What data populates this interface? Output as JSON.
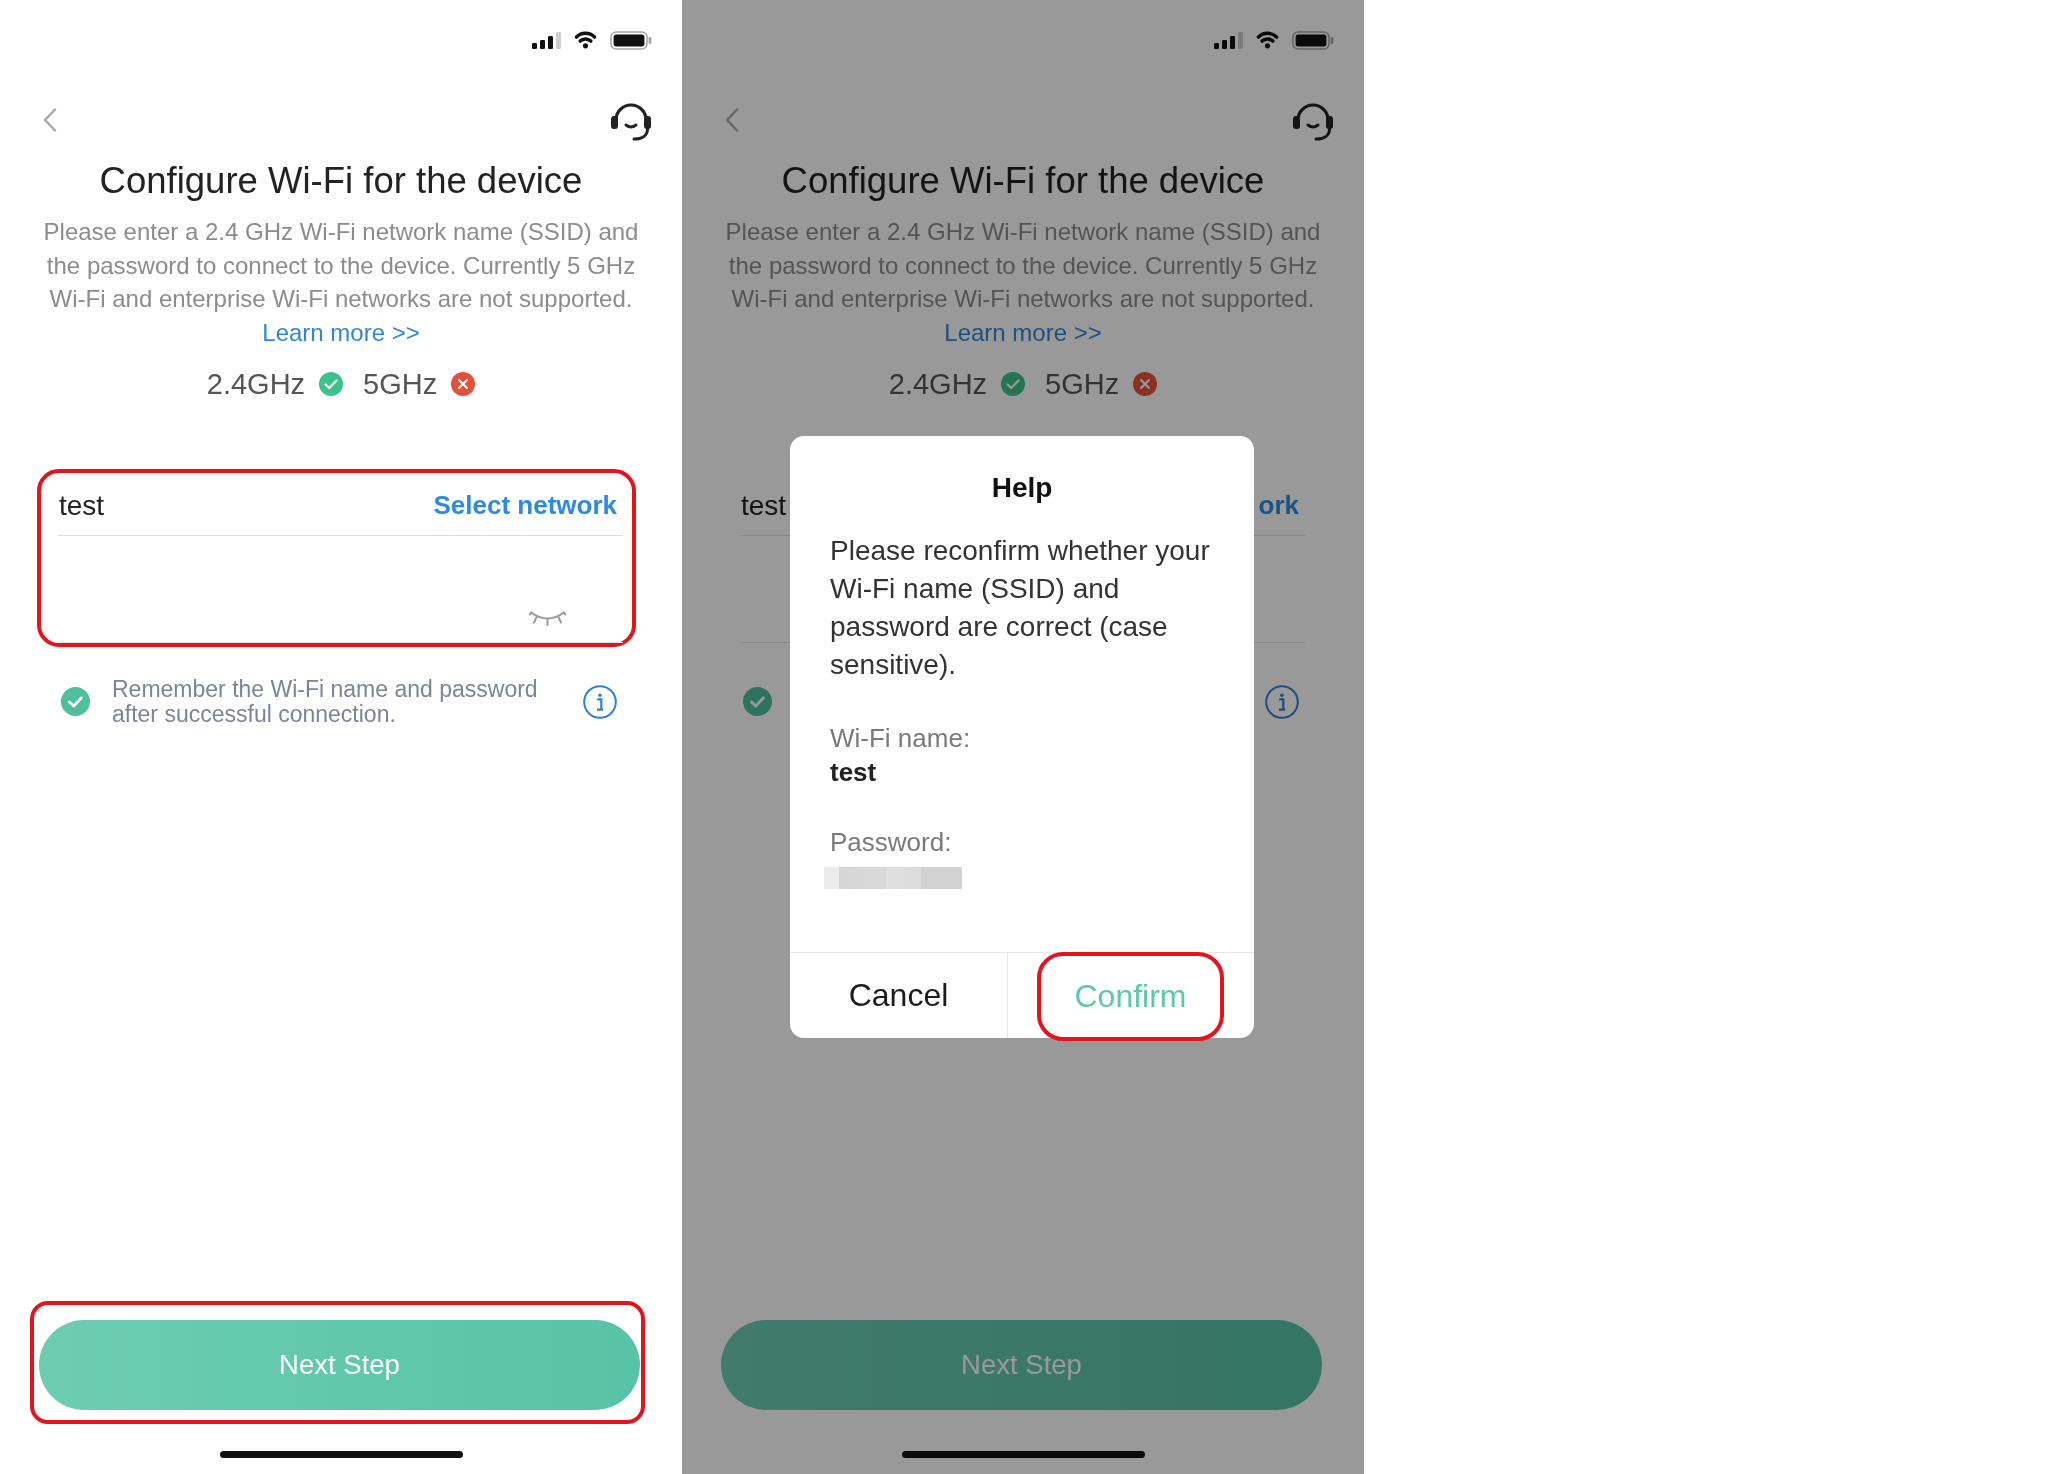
{
  "screens": [
    {
      "dimmed": false,
      "title": "Configure Wi-Fi for the device",
      "description": "Please enter a 2.4 GHz Wi-Fi network name (SSID) and the password to connect to the device. Currently 5 GHz Wi-Fi and enterprise Wi-Fi networks are not supported.",
      "learn_more": "Learn more >>",
      "bands": [
        {
          "label": "2.4GHz",
          "supported": true
        },
        {
          "label": "5GHz",
          "supported": false
        }
      ],
      "wifi_form": {
        "highlighted": true,
        "ssid": "test",
        "select_network": "Select network",
        "password_visible": false
      },
      "remember": {
        "checked": true,
        "label": "Remember the Wi-Fi name and password after successful connection."
      },
      "next_button": {
        "label": "Next Step",
        "highlighted": true
      }
    },
    {
      "dimmed": true,
      "title": "Configure Wi-Fi for the device",
      "description": "Please enter a 2.4 GHz Wi-Fi network name (SSID) and the password to connect to the device. Currently 5 GHz Wi-Fi and enterprise Wi-Fi networks are not supported.",
      "learn_more": "Learn more >>",
      "bands": [
        {
          "label": "2.4GHz",
          "supported": true
        },
        {
          "label": "5GHz",
          "supported": false
        }
      ],
      "wifi_form": {
        "ssid": "test",
        "select_network": "ork"
      },
      "remember": {
        "checked": true
      },
      "next_button": {
        "label": "Next Step"
      },
      "dialog": {
        "title": "Help",
        "message": "Please reconfirm whether your Wi-Fi name (SSID) and password are correct (case sensitive).",
        "fields": [
          {
            "label": "Wi-Fi name:",
            "value": "test"
          },
          {
            "label": "Password:",
            "redacted": true
          }
        ],
        "buttons": [
          {
            "label": "Cancel",
            "kind": "cancel"
          },
          {
            "label": "Confirm",
            "kind": "confirm",
            "highlighted": true
          }
        ]
      }
    }
  ]
}
